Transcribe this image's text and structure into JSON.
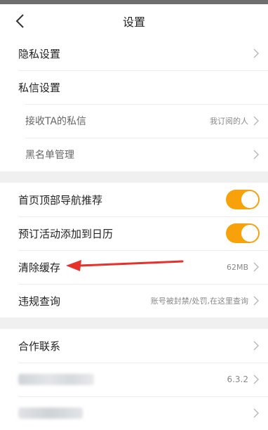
{
  "header": {
    "title": "设置"
  },
  "section1": {
    "privacy": "隐私设置",
    "dm_settings": "私信设置",
    "receive_dm": "接收TA的私信",
    "receive_dm_value": "我订阅的人",
    "blacklist": "黑名单管理"
  },
  "section2": {
    "home_nav": "首页顶部导航推荐",
    "home_nav_on": true,
    "calendar": "预订活动添加到日历",
    "calendar_on": true,
    "clear_cache": "清除缓存",
    "cache_size": "62MB",
    "violation": "违规查询",
    "violation_value": "账号被封禁/处罚,在这里查询"
  },
  "section3": {
    "contact": "合作联系",
    "version": "6.3.2"
  },
  "colors": {
    "toggle_on": "#f7a20b",
    "arrow": "#e8302a"
  },
  "icons": [
    "back-arrow-icon",
    "chevron-right-icon"
  ]
}
